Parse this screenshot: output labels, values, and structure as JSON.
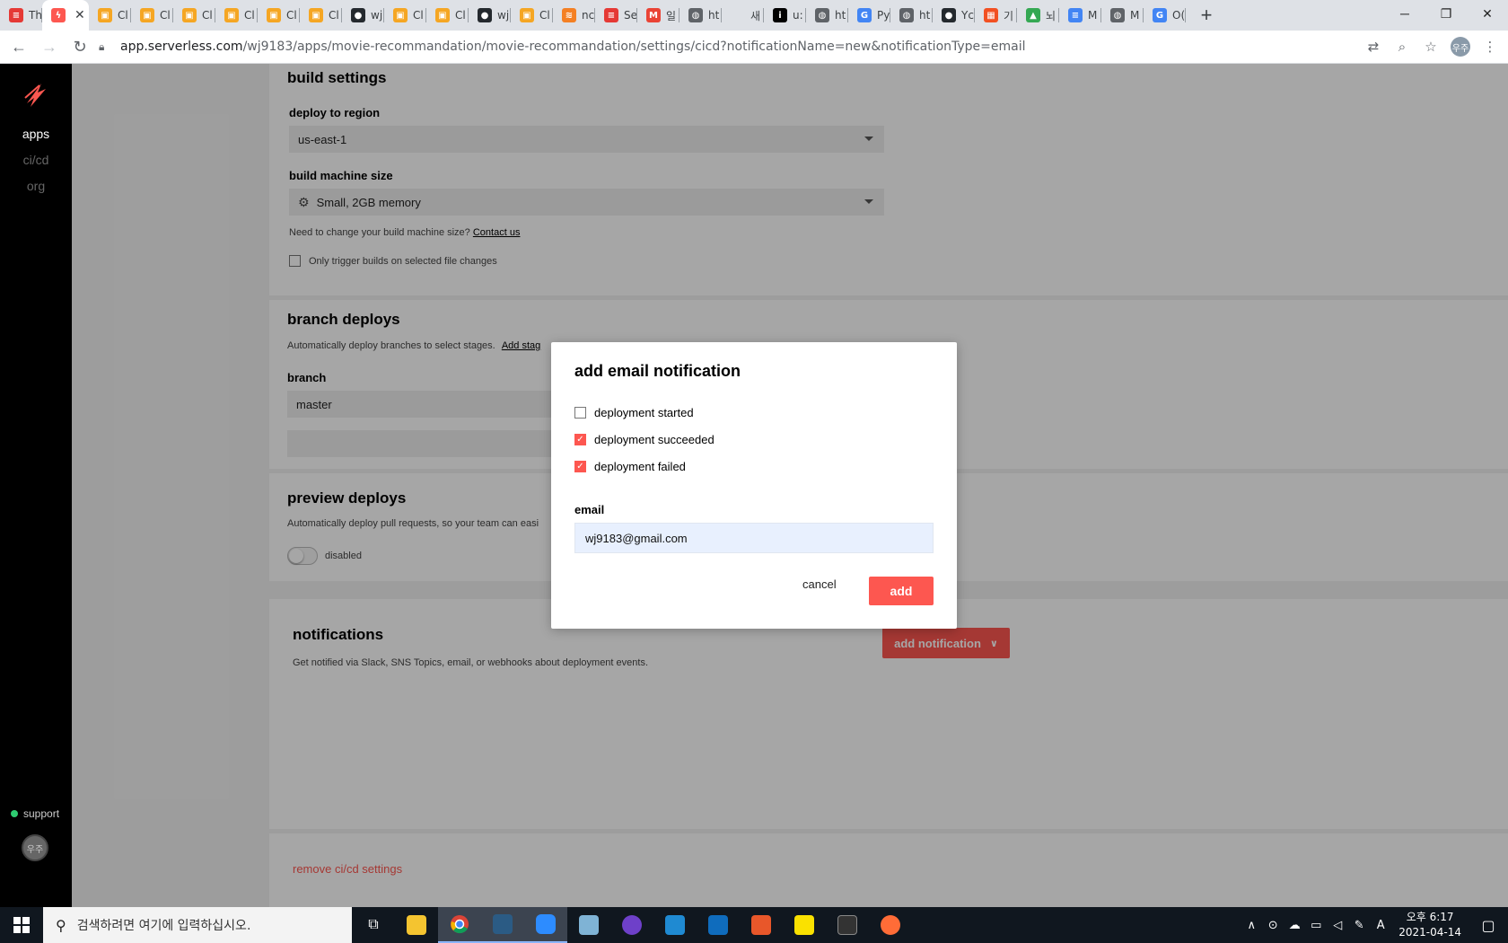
{
  "browser": {
    "tabs": [
      {
        "label": "Th",
        "color": "#e53935",
        "glyph": "≡"
      },
      {
        "label": "",
        "color": "#fd5750",
        "glyph": "ϟ",
        "active": true
      },
      {
        "label": "Cl",
        "color": "#f5a623",
        "glyph": "▣"
      },
      {
        "label": "Cl",
        "color": "#f5a623",
        "glyph": "▣"
      },
      {
        "label": "Cl",
        "color": "#f5a623",
        "glyph": "▣"
      },
      {
        "label": "Cl",
        "color": "#f5a623",
        "glyph": "▣"
      },
      {
        "label": "Cl",
        "color": "#f5a623",
        "glyph": "▣"
      },
      {
        "label": "Cl",
        "color": "#f5a623",
        "glyph": "▣"
      },
      {
        "label": "wj",
        "color": "#24292e",
        "glyph": "●"
      },
      {
        "label": "Cl",
        "color": "#f5a623",
        "glyph": "▣"
      },
      {
        "label": "Cl",
        "color": "#f5a623",
        "glyph": "▣"
      },
      {
        "label": "wj",
        "color": "#24292e",
        "glyph": "●"
      },
      {
        "label": "Cl",
        "color": "#f5a623",
        "glyph": "▣"
      },
      {
        "label": "nc",
        "color": "#f48024",
        "glyph": "≋"
      },
      {
        "label": "Se",
        "color": "#e53935",
        "glyph": "≡"
      },
      {
        "label": "일",
        "color": "#ea4335",
        "glyph": "M"
      },
      {
        "label": "ht",
        "color": "#5f6368",
        "glyph": "◍"
      },
      {
        "label": "새 탭",
        "color": "#dee1e6",
        "glyph": ""
      },
      {
        "label": "u:",
        "color": "#000000",
        "glyph": "i"
      },
      {
        "label": "ht",
        "color": "#5f6368",
        "glyph": "◍"
      },
      {
        "label": "Py",
        "color": "#4285f4",
        "glyph": "G"
      },
      {
        "label": "ht",
        "color": "#5f6368",
        "glyph": "◍"
      },
      {
        "label": "Yc",
        "color": "#24292e",
        "glyph": "●"
      },
      {
        "label": "기",
        "color": "#f25022",
        "glyph": "▦"
      },
      {
        "label": "뇌",
        "color": "#34a853",
        "glyph": "▲"
      },
      {
        "label": "M",
        "color": "#4285f4",
        "glyph": "≡"
      },
      {
        "label": "M",
        "color": "#5f6368",
        "glyph": "◍"
      },
      {
        "label": "O(",
        "color": "#4285f4",
        "glyph": "G"
      }
    ],
    "tab_close": "✕",
    "new_tab": "+",
    "url_host": "app.serverless.com",
    "url_path": "/wj9183/apps/movie-recommandation/movie-recommandation/settings/cicd?notificationName=new&notificationType=email",
    "profile_initials": "우주"
  },
  "sidebar": {
    "items": [
      "apps",
      "ci/cd",
      "org"
    ],
    "support": "support",
    "avatar_initials": "우주"
  },
  "build_settings": {
    "title": "build settings",
    "region_label": "deploy to region",
    "region_value": "us-east-1",
    "machine_label": "build machine size",
    "machine_value": "Small, 2GB memory",
    "machine_help": "Need to change your build machine size?",
    "contact_link": "Contact us",
    "trigger_label": "Only trigger builds on selected file changes"
  },
  "branch_deploys": {
    "title": "branch deploys",
    "description": "Automatically deploy branches to select stages.",
    "add_link": "Add stag",
    "branch_label": "branch",
    "branch_value": "master"
  },
  "preview_deploys": {
    "title": "preview deploys",
    "description": "Automatically deploy pull requests, so your team can easi",
    "toggle_state": "disabled"
  },
  "notifications": {
    "title": "notifications",
    "description": "Get notified via Slack, SNS Topics, email, or webhooks about deployment events.",
    "add_button": "add notification"
  },
  "remove_link": "remove ci/cd settings",
  "modal": {
    "title": "add email notification",
    "options": [
      {
        "label": "deployment started",
        "checked": false
      },
      {
        "label": "deployment succeeded",
        "checked": true
      },
      {
        "label": "deployment failed",
        "checked": true
      }
    ],
    "email_label": "email",
    "email_value": "wj9183@gmail.com",
    "cancel": "cancel",
    "add": "add"
  },
  "taskbar": {
    "search_placeholder": "검색하려면 여기에 입력하십시오.",
    "time": "오후 6:17",
    "date": "2021-04-14",
    "ime": "A"
  },
  "colors": {
    "accent": "#fd5750",
    "sidebar": "#000000"
  }
}
